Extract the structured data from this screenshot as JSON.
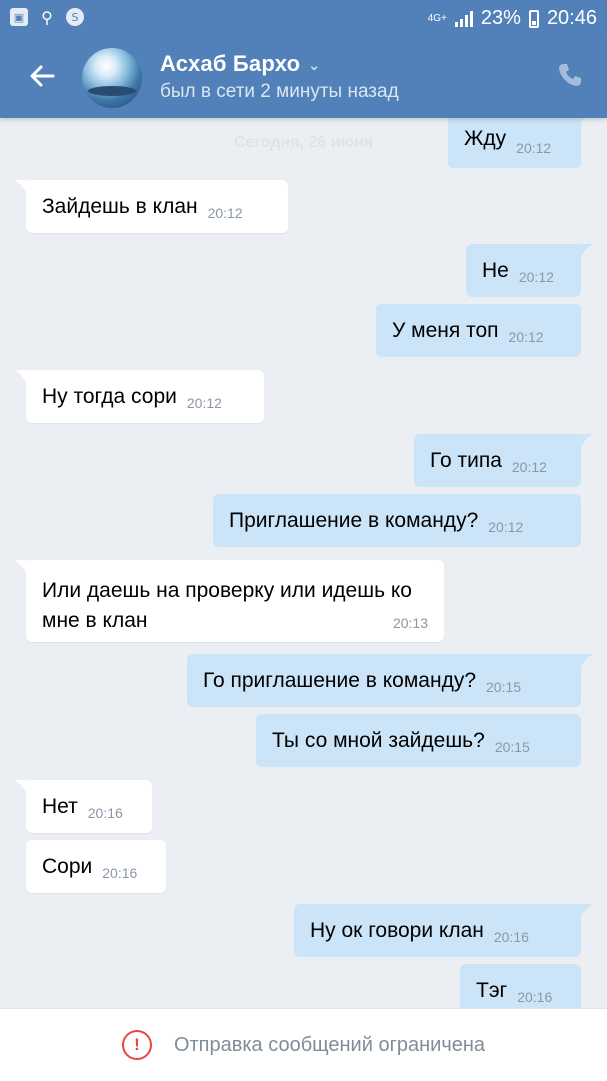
{
  "status_bar": {
    "network": "4G+",
    "battery": "23%",
    "time": "20:46"
  },
  "header": {
    "name": "Асхаб Бархо",
    "status": "был в сети 2 минуты назад"
  },
  "chat": {
    "date_separator": "Сегодня, 26 июня",
    "messages": [
      {
        "dir": "out",
        "text": "Жду",
        "time": "20:12"
      },
      {
        "dir": "in",
        "text": "Зайдешь в клан",
        "time": "20:12"
      },
      {
        "dir": "out",
        "text": "Не",
        "time": "20:12"
      },
      {
        "dir": "out",
        "text": "У меня топ",
        "time": "20:12"
      },
      {
        "dir": "in",
        "text": "Ну тогда сори",
        "time": "20:12"
      },
      {
        "dir": "out",
        "text": "Го типа",
        "time": "20:12"
      },
      {
        "dir": "out",
        "text": "Приглашение в команду?",
        "time": "20:12"
      },
      {
        "dir": "in",
        "text": "Или даешь на проверку или идешь ко мне в клан",
        "time": "20:13"
      },
      {
        "dir": "out",
        "text": "Го приглашение в команду?",
        "time": "20:15"
      },
      {
        "dir": "out",
        "text": "Ты со мной зайдешь?",
        "time": "20:15"
      },
      {
        "dir": "in",
        "text": "Нет",
        "time": "20:16"
      },
      {
        "dir": "in",
        "text": "Сори",
        "time": "20:16"
      },
      {
        "dir": "out",
        "text": "Ну ок говори клан",
        "time": "20:16"
      },
      {
        "dir": "out",
        "text": "Тэг",
        "time": "20:16"
      }
    ]
  },
  "bottom": {
    "restriction_text": "Отправка сообщений ограничена"
  },
  "colors": {
    "header": "#5181b8",
    "chat_bg": "#ebeef2",
    "bubble_in": "#ffffff",
    "bubble_out": "#cce4f8",
    "warning": "#e64646"
  }
}
